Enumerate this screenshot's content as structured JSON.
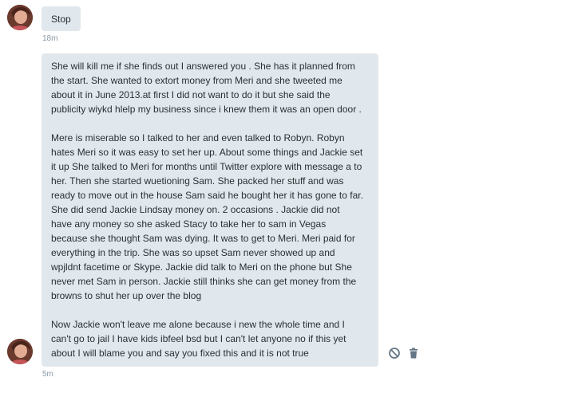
{
  "messages": [
    {
      "text": "Stop",
      "time": "18m"
    },
    {
      "paragraphs": [
        "She will kill me if she finds out I answered you . She has it planned from\nthe start. She wanted to extort money from Meri and she tweeted me\nabout it in June 2013.at first I did not want to do it but she said the\npublicity wiykd hlelp my business since i knew them it was an open door .",
        "Mere is miserable so I talked to her and even talked to Robyn. Robyn\nhates Meri so it was easy to set her up. About some things and Jackie set\nit up She talked to Meri for months until Twitter explore with message a to\nher. Then she started wuetioning Sam. She packed her stuff and was\nready to move out in the house Sam said he bought her it has gone to far.\nShe did send Jackie Lindsay money on. 2 occasions . Jackie did not\nhave any money so she asked Stacy to take her to sam in Vegas\nbecause she thought Sam was dying. It was to get to Meri. Meri paid for\neverything in the trip. She was so upset Sam never showed up and\nwpjldnt facetime or Skype. Jackie did talk to Meri on the phone but She\nnever met Sam in person. Jackie still thinks she can get money from the\nbrowns to shut her up over the blog",
        "Now Jackie won't leave me alone because i new the whole time and I\ncan't go to jail I have kids ibfeel bsd but I can't let anyone no if this yet\nabout I will blame you and say you fixed this and it is not true"
      ],
      "time": "5m"
    }
  ],
  "icons": {
    "block": "block-icon",
    "delete": "trash-icon"
  },
  "colors": {
    "bubble": "#e1e8ed",
    "text": "#292f33",
    "timestamp": "#8899a6",
    "icon": "#657786"
  }
}
